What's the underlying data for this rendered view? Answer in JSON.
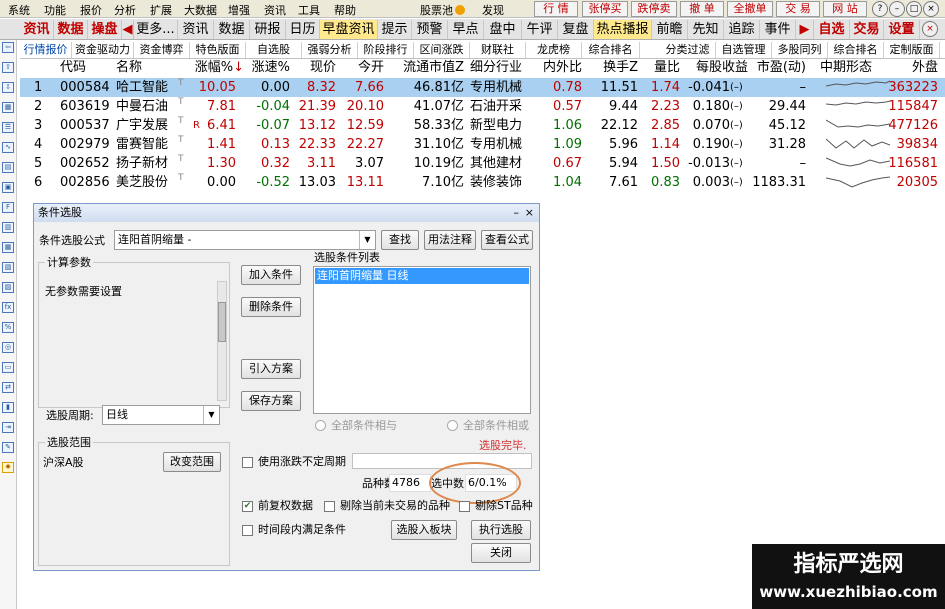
{
  "menubar": {
    "items": [
      "系统",
      "功能",
      "报价",
      "分析",
      "扩展",
      "大数据",
      "增强",
      "资讯",
      "工具",
      "帮助"
    ],
    "stock_pool": "股票池",
    "discover": "发现",
    "right_buttons": [
      "行 情",
      "张停买",
      "跌停卖",
      "撤 单",
      "全撤单",
      "交 易",
      "网 站"
    ]
  },
  "navbar": {
    "items": [
      {
        "label": "资讯",
        "red": true
      },
      {
        "label": "数据",
        "red": true
      },
      {
        "label": "操盘",
        "red": true
      },
      {
        "label": "更多...",
        "red": false
      },
      {
        "label": "资讯",
        "red": false
      },
      {
        "label": "数据",
        "red": false
      },
      {
        "label": "研报",
        "red": false
      },
      {
        "label": "日历",
        "red": false
      },
      {
        "label": "早盘资讯",
        "red": false,
        "highlight": true
      },
      {
        "label": "提示",
        "red": false
      },
      {
        "label": "预警",
        "red": false
      },
      {
        "label": "早点",
        "red": false
      },
      {
        "label": "盘中",
        "red": false
      },
      {
        "label": "午评",
        "red": false
      },
      {
        "label": "复盘",
        "red": false
      },
      {
        "label": "热点播报",
        "red": false,
        "highlight": true
      },
      {
        "label": "前瞻",
        "red": false
      },
      {
        "label": "先知",
        "red": false
      },
      {
        "label": "追踪",
        "red": false
      },
      {
        "label": "事件",
        "red": false
      },
      {
        "label": "自选",
        "red": true
      },
      {
        "label": "交易",
        "red": true
      },
      {
        "label": "设置",
        "red": true
      }
    ]
  },
  "subbar": {
    "items": [
      "行情报价",
      "资金驱动力",
      "资金博弈",
      "特色版面",
      "自选股",
      "强弱分析",
      "阶段排行",
      "区间涨跌",
      "财联社",
      "龙虎榜",
      "综合排名",
      "分类过滤",
      "自选管理",
      "多股同列",
      "综合排名",
      "定制版面"
    ]
  },
  "table": {
    "headers": [
      "代码",
      "名称",
      "涨幅%",
      "涨速%",
      "现价",
      "今开",
      "流通市值Z",
      "细分行业",
      "内外比",
      "换手Z",
      "量比",
      "每股收益",
      "市盈(动)",
      "中期形态",
      "外盘"
    ],
    "rows": [
      {
        "idx": "1",
        "code": "000584",
        "name": "哈工智能",
        "mark": "",
        "chg": "10.05",
        "speed": "0.00",
        "price": "8.32",
        "open": "7.66",
        "mcap": "46.81亿",
        "ind": "专用机械",
        "ratio": "0.78",
        "turn": "11.51",
        "vol": "1.74",
        "eps": "-0.041",
        "pe": "–",
        "outer": "363223",
        "spark": "0,6 10,4 20,5 30,3 40,4 50,2 60,3 64,1"
      },
      {
        "idx": "2",
        "code": "603619",
        "name": "中曼石油",
        "mark": "",
        "chg": "7.81",
        "speed": "-0.04",
        "price": "21.39",
        "open": "20.10",
        "mcap": "41.07亿",
        "ind": "石油开采",
        "ratio": "0.57",
        "turn": "9.44",
        "vol": "2.23",
        "eps": "0.180",
        "pe": "29.44",
        "outer": "115847",
        "spark": "0,5 10,6 20,4 30,5 40,3 50,4 60,3 64,2"
      },
      {
        "idx": "3",
        "code": "000537",
        "name": "广宇发展",
        "mark": "R",
        "chg": "6.41",
        "speed": "-0.07",
        "price": "13.12",
        "open": "12.59",
        "mcap": "58.33亿",
        "ind": "新型电力",
        "ratio": "1.06",
        "turn": "22.12",
        "vol": "2.85",
        "eps": "0.070",
        "pe": "45.12",
        "outer": "477126",
        "spark": "0,2 12,9 22,8 32,9 42,7 52,8 64,6"
      },
      {
        "idx": "4",
        "code": "002979",
        "name": "雷赛智能",
        "mark": "",
        "chg": "1.41",
        "speed": "0.13",
        "price": "22.33",
        "open": "22.27",
        "mcap": "31.10亿",
        "ind": "专用机械",
        "ratio": "1.09",
        "turn": "5.96",
        "vol": "1.14",
        "eps": "0.190",
        "pe": "31.28",
        "outer": "39834",
        "spark": "0,2 10,11 20,4 28,11 38,3 46,9 56,5 64,8"
      },
      {
        "idx": "5",
        "code": "002652",
        "name": "扬子新材",
        "mark": "",
        "chg": "1.30",
        "speed": "0.32",
        "price": "3.11",
        "open": "3.07",
        "mcap": "10.19亿",
        "ind": "其他建材",
        "ratio": "0.67",
        "turn": "5.94",
        "vol": "1.50",
        "eps": "-0.013",
        "pe": "–",
        "outer": "116581",
        "spark": "0,2 14,8 24,10 34,8 44,4 54,7 64,5"
      },
      {
        "idx": "6",
        "code": "002856",
        "name": "美芝股份",
        "mark": "",
        "chg": "0.00",
        "speed": "-0.52",
        "price": "13.03",
        "open": "13.11",
        "mcap": "7.10亿",
        "ind": "装修装饰",
        "ratio": "1.04",
        "turn": "7.61",
        "vol": "0.83",
        "eps": "0.003",
        "pe": "1183.31",
        "outer": "20305",
        "spark": "0,3 14,6 26,12 36,8 46,5 56,3 64,2"
      }
    ]
  },
  "dialog": {
    "title": "条件选股",
    "formula_label": "条件选股公式",
    "formula_value": "连阳首阴缩量 -",
    "btn_view": "查找",
    "btn_usage": "用法注释",
    "btn_formula": "查看公式",
    "calc_params": "计算参数",
    "no_params": "无参数需要设置",
    "btn_add": "加入条件",
    "btn_delete": "删除条件",
    "btn_import": "引入方案",
    "btn_save": "保存方案",
    "condition_list_label": "选股条件列表",
    "condition_item": "连阳首阴缩量  日线",
    "radio_and": "全部条件相与",
    "radio_or": "全部条件相或",
    "period_label": "选股周期:",
    "period_value": "日线",
    "scope_label": "选股范围",
    "scope_value": "沪深A股",
    "btn_scope": "改变范围",
    "status": "选股完毕.",
    "use_period_label": "使用涨跌不定周期",
    "count_label": "品种数",
    "count_value": "4786",
    "hit_label": "选中数",
    "hit_value": "6/0.1%",
    "chk_prefq": "前复权数据",
    "chk_remove_today": "剔除当前未交易的品种",
    "chk_remove_st": "剔除ST品种",
    "chk_interval": "时间段内满足条件",
    "btn_to_block": "选股入板块",
    "btn_run": "执行选股",
    "btn_close": "关闭"
  },
  "watermark": {
    "title": "指标严选网",
    "url": "www.xuezhibiao.com"
  },
  "colors": {
    "up": "#c00000",
    "down": "#007000",
    "selected_row": "#a9d0f0",
    "highlight_circle": "#e0884c"
  }
}
